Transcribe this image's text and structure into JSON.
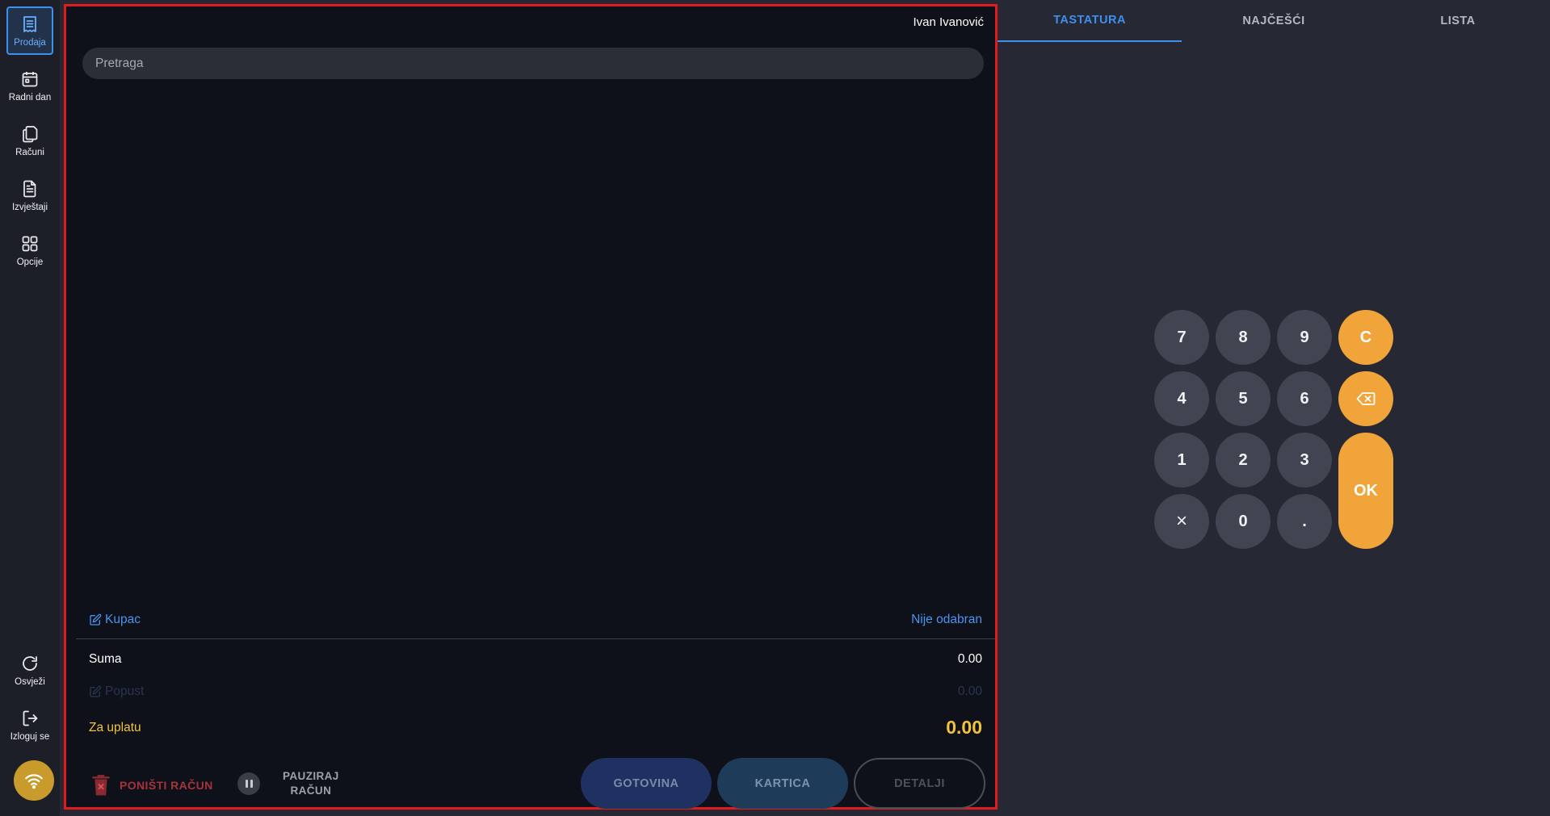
{
  "sidebar": {
    "items": [
      {
        "label": "Prodaja",
        "icon": "receipt-icon",
        "active": true
      },
      {
        "label": "Radni dan",
        "icon": "calendar-icon"
      },
      {
        "label": "Računi",
        "icon": "copy-icon"
      },
      {
        "label": "Izvještaji",
        "icon": "document-icon"
      },
      {
        "label": "Opcije",
        "icon": "grid-icon"
      }
    ],
    "bottom": [
      {
        "label": "Osvježi",
        "icon": "refresh-icon"
      },
      {
        "label": "Izloguj se",
        "icon": "logout-icon"
      }
    ],
    "status_icon": "wifi-icon"
  },
  "main": {
    "user_name": "Ivan Ivanović",
    "search_placeholder": "Pretraga",
    "customer_label": "Kupac",
    "customer_value": "Nije odabran",
    "sum_label": "Suma",
    "sum_value": "0.00",
    "discount_label": "Popust",
    "discount_value": "0.00",
    "total_label": "Za uplatu",
    "total_value": "0.00",
    "cancel_label": "PONIŠTI RAČUN",
    "pause_label_1": "PAUZIRAJ",
    "pause_label_2": "RAČUN",
    "cash_label": "GOTOVINA",
    "card_label": "KARTICA",
    "details_label": "DETALJI"
  },
  "tabs": [
    {
      "label": "TASTATURA",
      "active": true
    },
    {
      "label": "NAJČEŠĆI"
    },
    {
      "label": "LISTA"
    }
  ],
  "keypad": {
    "keys": [
      "7",
      "8",
      "9",
      "C",
      "4",
      "5",
      "6",
      "1",
      "2",
      "3",
      "×",
      "0",
      ".",
      "OK"
    ],
    "backspace_icon": "backspace-icon"
  },
  "colors": {
    "accent": "#3d8ff0",
    "highlight": "#f0a43a",
    "total": "#f2c33a",
    "panel_border": "#e11b1b"
  }
}
